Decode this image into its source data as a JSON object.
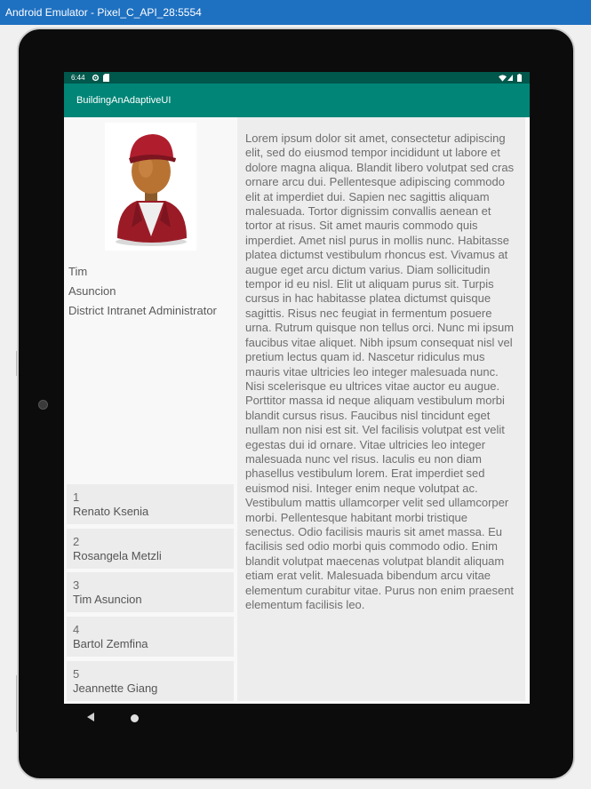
{
  "window": {
    "title": "Android Emulator - Pixel_C_API_28:5554"
  },
  "status_bar": {
    "time": "6:44",
    "icons": [
      "settings-icon",
      "sd-card-icon",
      "wifi-icon",
      "signal-icon",
      "battery-icon"
    ]
  },
  "app_bar": {
    "title": "BuildingAnAdaptiveUI"
  },
  "profile": {
    "avatar_icon": "user-avatar-icon",
    "first_name": "Tim",
    "last_name": "Asuncion",
    "role": "District Intranet Administrator"
  },
  "people": [
    {
      "id": "1",
      "name": "Renato Ksenia"
    },
    {
      "id": "2",
      "name": "Rosangela Metzli"
    },
    {
      "id": "3",
      "name": "Tim Asuncion"
    },
    {
      "id": "4",
      "name": "Bartol Zemfina"
    },
    {
      "id": "5",
      "name": "Jeannette Giang"
    }
  ],
  "detail": {
    "text": "Lorem ipsum dolor sit amet, consectetur adipiscing elit, sed do eiusmod tempor incididunt ut labore et dolore magna aliqua. Blandit libero volutpat sed cras ornare arcu dui. Pellentesque adipiscing commodo elit at imperdiet dui. Sapien nec sagittis aliquam malesuada. Tortor dignissim convallis aenean et tortor at risus. Sit amet mauris commodo quis imperdiet. Amet nisl purus in mollis nunc. Habitasse platea dictumst vestibulum rhoncus est. Vivamus at augue eget arcu dictum varius. Diam sollicitudin tempor id eu nisl. Elit ut aliquam purus sit. Turpis cursus in hac habitasse platea dictumst quisque sagittis. Risus nec feugiat in fermentum posuere urna. Rutrum quisque non tellus orci. Nunc mi ipsum faucibus vitae aliquet. Nibh ipsum consequat nisl vel pretium lectus quam id. Nascetur ridiculus mus mauris vitae ultricies leo integer malesuada nunc. Nisi scelerisque eu ultrices vitae auctor eu augue. Porttitor massa id neque aliquam vestibulum morbi blandit cursus risus. Faucibus nisl tincidunt eget nullam non nisi est sit. Vel facilisis volutpat est velit egestas dui id ornare. Vitae ultricies leo integer malesuada nunc vel risus. Iaculis eu non diam phasellus vestibulum lorem. Erat imperdiet sed euismod nisi. Integer enim neque volutpat ac. Vestibulum mattis ullamcorper velit sed ullamcorper morbi. Pellentesque habitant morbi tristique senectus. Odio facilisis mauris sit amet massa. Eu facilisis sed odio morbi quis commodo odio. Enim blandit volutpat maecenas volutpat blandit aliquam etiam erat velit. Malesuada bibendum arcu vitae elementum curabitur vitae. Purus non enim praesent elementum facilisis leo."
  },
  "nav_bar": {
    "icons": [
      "back-icon",
      "home-icon"
    ]
  },
  "colors": {
    "status_bar": "#00574b",
    "app_bar": "#008577",
    "window_titlebar": "#1e70c1"
  }
}
